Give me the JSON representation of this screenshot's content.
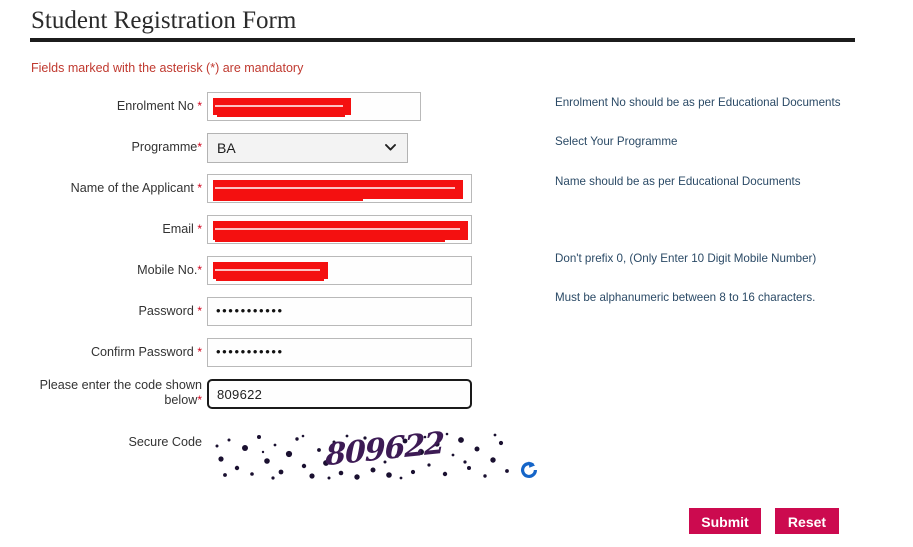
{
  "page": {
    "title": "Student Registration Form",
    "mandatory_note": "Fields marked with the asterisk (*) are mandatory"
  },
  "fields": [
    {
      "label": "Enrolment No",
      "required_mark": "*",
      "type": "text",
      "value": "",
      "redacted": true,
      "hint": "Enrolment No should be as per Educational Documents"
    },
    {
      "label": "Programme",
      "required_mark": "*",
      "type": "select",
      "value": "BA",
      "redacted": false,
      "hint": "Select Your Programme"
    },
    {
      "label": "Name of the Applicant",
      "required_mark": "*",
      "type": "text",
      "value": "",
      "redacted": true,
      "hint": "Name should be as per Educational Documents"
    },
    {
      "label": "Email",
      "required_mark": "*",
      "type": "email",
      "value": "",
      "redacted": true,
      "hint": ""
    },
    {
      "label": "Mobile No.",
      "required_mark": "*",
      "type": "tel",
      "value": "",
      "redacted": true,
      "hint": "Don't prefix 0, (Only Enter 10 Digit Mobile Number)"
    },
    {
      "label": "Password",
      "required_mark": "*",
      "type": "password",
      "value": "•••••••••••",
      "redacted": false,
      "hint": "Must be alphanumeric between 8 to 16 characters."
    },
    {
      "label": "Confirm Password",
      "required_mark": "*",
      "type": "password",
      "value": "•••••••••••",
      "redacted": false,
      "hint": ""
    }
  ],
  "captcha": {
    "input_label_line1": "Please enter the code shown",
    "input_label_line2": "below",
    "input_required_mark": "*",
    "input_value": "809622",
    "image_label": "Secure Code",
    "image_code": "809622",
    "refresh_icon": "refresh-icon"
  },
  "actions": {
    "submit_label": "Submit",
    "reset_label": "Reset"
  },
  "colors": {
    "accent_button": "#cc0a4f",
    "required_asterisk": "#d0021b",
    "mandatory_note": "#c0392f",
    "hint_text": "#2b4a66",
    "captcha_code": "#3d1b55",
    "refresh_icon": "#1565c8",
    "redaction": "#f41010"
  }
}
